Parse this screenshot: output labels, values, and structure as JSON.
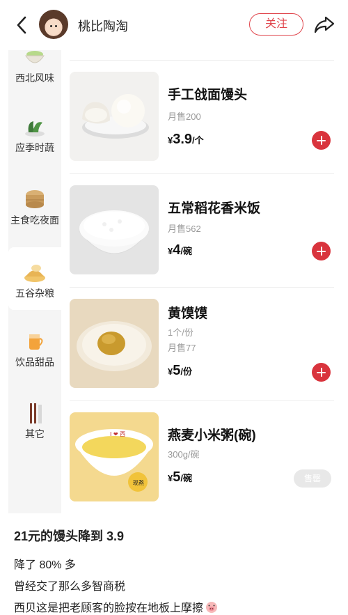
{
  "header": {
    "username": "桃比陶淘",
    "follow_label": "关注",
    "icons": [
      "back-icon",
      "avatar",
      "share-icon"
    ]
  },
  "sidebar": {
    "items": [
      {
        "label": "西北风味",
        "icon": "soup-bowl-icon",
        "active": false
      },
      {
        "label": "应季时蔬",
        "icon": "vegetable-icon",
        "active": false
      },
      {
        "label": "主食吃夜面",
        "icon": "steamer-icon",
        "active": false
      },
      {
        "label": "五谷杂粮",
        "icon": "grain-icon",
        "active": true
      },
      {
        "label": "饮品甜品",
        "icon": "drink-icon",
        "active": false
      },
      {
        "label": "其它",
        "icon": "chopsticks-icon",
        "active": false
      }
    ]
  },
  "products": [
    {
      "name": "手工戗面馒头",
      "sub": [
        "月售200"
      ],
      "currency": "¥",
      "price": "3.9",
      "unit": "/个",
      "action": "add",
      "image": "steamed-bun-image"
    },
    {
      "name": "五常稻花香米饭",
      "sub": [
        "月售562"
      ],
      "currency": "¥",
      "price": "4",
      "unit": "/碗",
      "action": "add",
      "image": "rice-bowl-image"
    },
    {
      "name": "黄馍馍",
      "sub": [
        "1个/份",
        "月售77"
      ],
      "currency": "¥",
      "price": "5",
      "unit": "/份",
      "action": "add",
      "image": "yellow-bun-image"
    },
    {
      "name": "燕麦小米粥(碗)",
      "sub": [
        "300g/碗"
      ],
      "currency": "¥",
      "price": "5",
      "unit": "/碗",
      "action": "sold_out",
      "sold_out_label": "售罄",
      "image": "millet-porridge-image",
      "bowl_text": "I ❤ 西",
      "bowl_badge": "现熬"
    }
  ],
  "post": {
    "title": "21元的馒头降到 3.9",
    "lines": [
      "降了 80% 多",
      "曾经交了那么多智商税",
      "西贝这是把老顾客的脸按在地板上摩擦"
    ]
  },
  "colors": {
    "accent": "#d9343d",
    "follow": "#e0454c",
    "sidebar_bg": "#f5f5f5",
    "muted": "#999999"
  }
}
